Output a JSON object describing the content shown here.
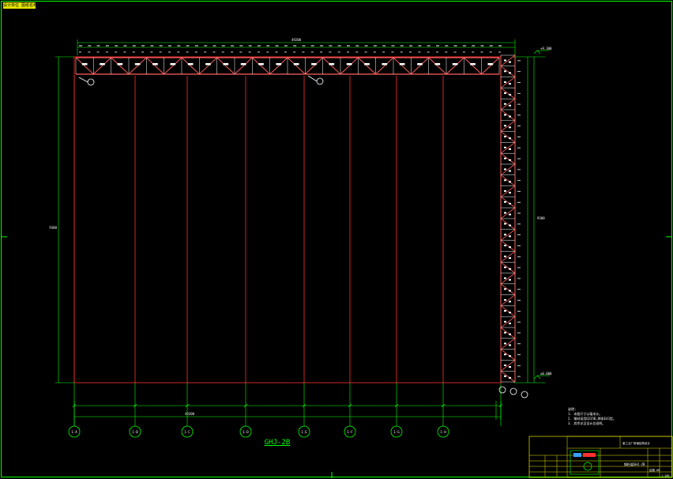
{
  "corner_tag": "设计单位 图纸名称",
  "drawing_title": "GHJ-2B",
  "elevation_marks": {
    "top": "+9.300",
    "bottom": "±0.000"
  },
  "axis_labels": [
    "1-A",
    "1-B",
    "1-C",
    "1-D",
    "1-E",
    "1-F",
    "1-G",
    "1-H",
    "1-I"
  ],
  "overall_dimensions": {
    "top": "49200",
    "bottom": "49200",
    "left": "9300",
    "right": "9300"
  },
  "notes": {
    "heading": "说明:",
    "lines": [
      "1. 本图尺寸以毫米计。",
      "2. 钢材采用Q235B,焊条E43型。",
      "3. 其余详见设计总说明。"
    ]
  },
  "title_block": {
    "project": "某工业厂房钢结构设计",
    "drawing_name": "钢桁架GHJ-2B",
    "drawing_no": "结施-08",
    "scale": "1:100"
  },
  "colors": {
    "background": "#000000",
    "frame": "#00ff00",
    "truss": "#ff6060",
    "axis_line": "#ff3030",
    "member_white": "#ffffff",
    "title_block_yellow": "#e6e600"
  }
}
